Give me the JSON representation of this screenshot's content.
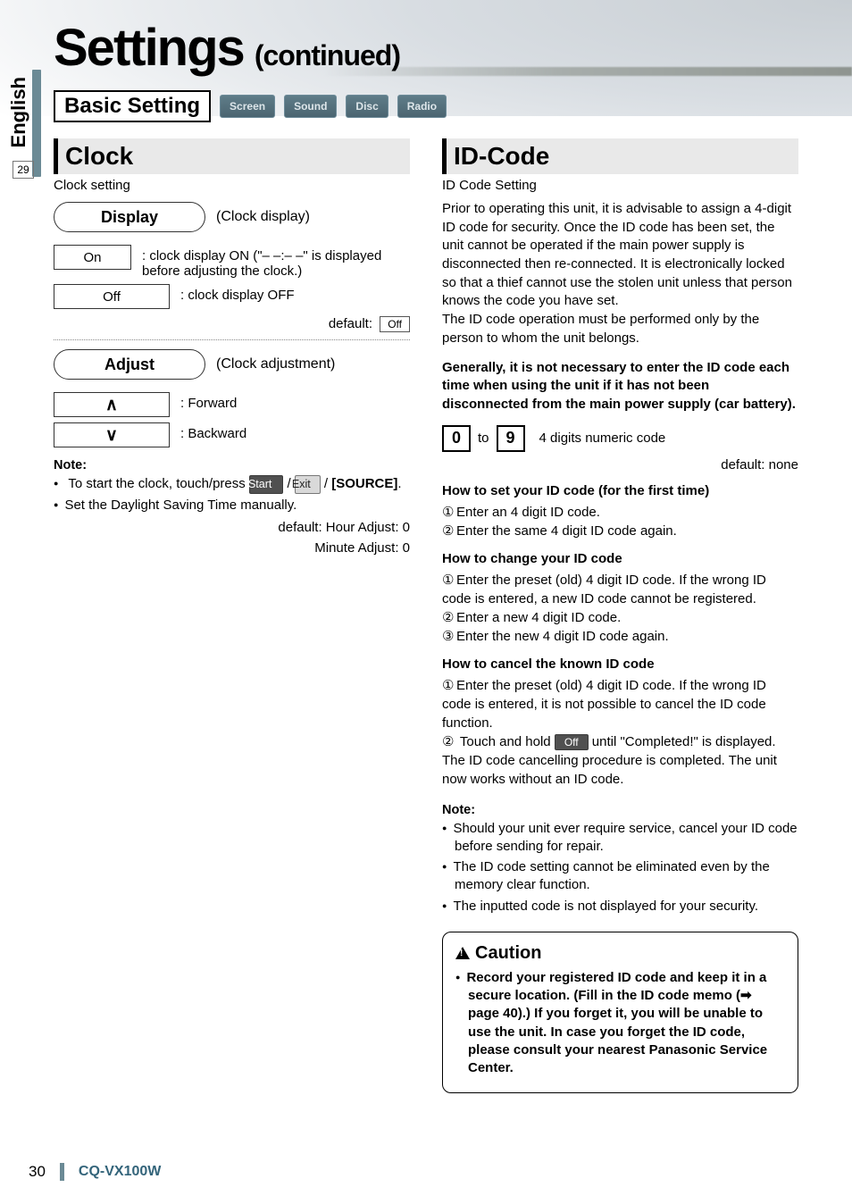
{
  "sideTab": {
    "language": "English",
    "prevPage": "29"
  },
  "title": {
    "main": "Settings",
    "sub": "(continued)"
  },
  "basic": {
    "label": "Basic Setting",
    "chips": [
      "Screen",
      "Sound",
      "Disc",
      "Radio"
    ]
  },
  "clock": {
    "heading": "Clock",
    "subheading": "Clock setting",
    "display": {
      "pill": "Display",
      "pillDesc": "(Clock display)",
      "on": {
        "box": "On",
        "text": ": clock display ON (\"– –:– –\" is displayed before adjusting the clock.)"
      },
      "off": {
        "box": "Off",
        "text": ": clock display OFF"
      },
      "defaultLabel": "default:",
      "defaultValue": "Off"
    },
    "adjust": {
      "pill": "Adjust",
      "pillDesc": "(Clock adjustment)",
      "fwd": {
        "sym": "∧",
        "text": ": Forward"
      },
      "bwd": {
        "sym": "∨",
        "text": ": Backward"
      }
    },
    "note": {
      "head": "Note:",
      "item1a": "To start the clock, touch/press ",
      "startBtn": "Start",
      "sep": " / ",
      "exitBtn": "Exit",
      "item1b": " / ",
      "item1c": "[SOURCE]",
      "item1d": ".",
      "item2": "Set the Daylight Saving Time manually.",
      "def1": "default: Hour Adjust: 0",
      "def2": "Minute Adjust: 0"
    }
  },
  "idcode": {
    "heading": "ID-Code",
    "subheading": "ID Code Setting",
    "intro": "Prior to operating this unit, it is advisable to assign a 4-digit ID code for security. Once the ID code has been set, the unit cannot be operated if the main power supply is disconnected then re-connected. It is electronically locked so that a thief cannot use the stolen unit unless that person knows the code you have set.",
    "intro2": "The ID code operation must be performed only by the person to whom the unit belongs.",
    "generally": "Generally, it is not necessary to enter the ID code each time when using the unit if it has not been disconnected from the main power supply (car battery).",
    "digits": {
      "d0": "0",
      "to": "to",
      "d9": "9",
      "label": "4 digits numeric code"
    },
    "defaultLine": "default: none",
    "howSet": {
      "title": "How to set your ID code (for the first time)",
      "s1": "Enter an 4 digit ID code.",
      "s2": "Enter the same 4 digit ID code again."
    },
    "howChange": {
      "title": "How to change your ID code",
      "s1": "Enter the preset (old) 4 digit ID code. If the wrong ID code is entered, a new ID code cannot be registered.",
      "s2": "Enter a new 4 digit ID code.",
      "s3": "Enter the new 4 digit ID code again."
    },
    "howCancel": {
      "title": "How to cancel the known ID code",
      "s1": "Enter the preset (old) 4 digit ID code. If the wrong ID code is entered, it is not possible to cancel the ID code function.",
      "s2a": "Touch and hold ",
      "offBtn": "Off",
      "s2b": " until \"Completed!\" is displayed. The ID code cancelling procedure is completed. The unit now works without an ID code."
    },
    "note": {
      "head": "Note:",
      "n1": "Should your unit ever require service, cancel your ID code before sending for repair.",
      "n2": "The ID code setting cannot be eliminated even by the memory clear function.",
      "n3": "The inputted code is not displayed for your security."
    },
    "caution": {
      "title": "Caution",
      "body": "Record your registered ID code and keep it in a secure location. (Fill in the ID code memo (➡ page 40).) If you forget it, you will be unable to use the unit. In case you forget the ID code, please consult your nearest Panasonic Service Center."
    }
  },
  "footer": {
    "page": "30",
    "model": "CQ-VX100W"
  }
}
